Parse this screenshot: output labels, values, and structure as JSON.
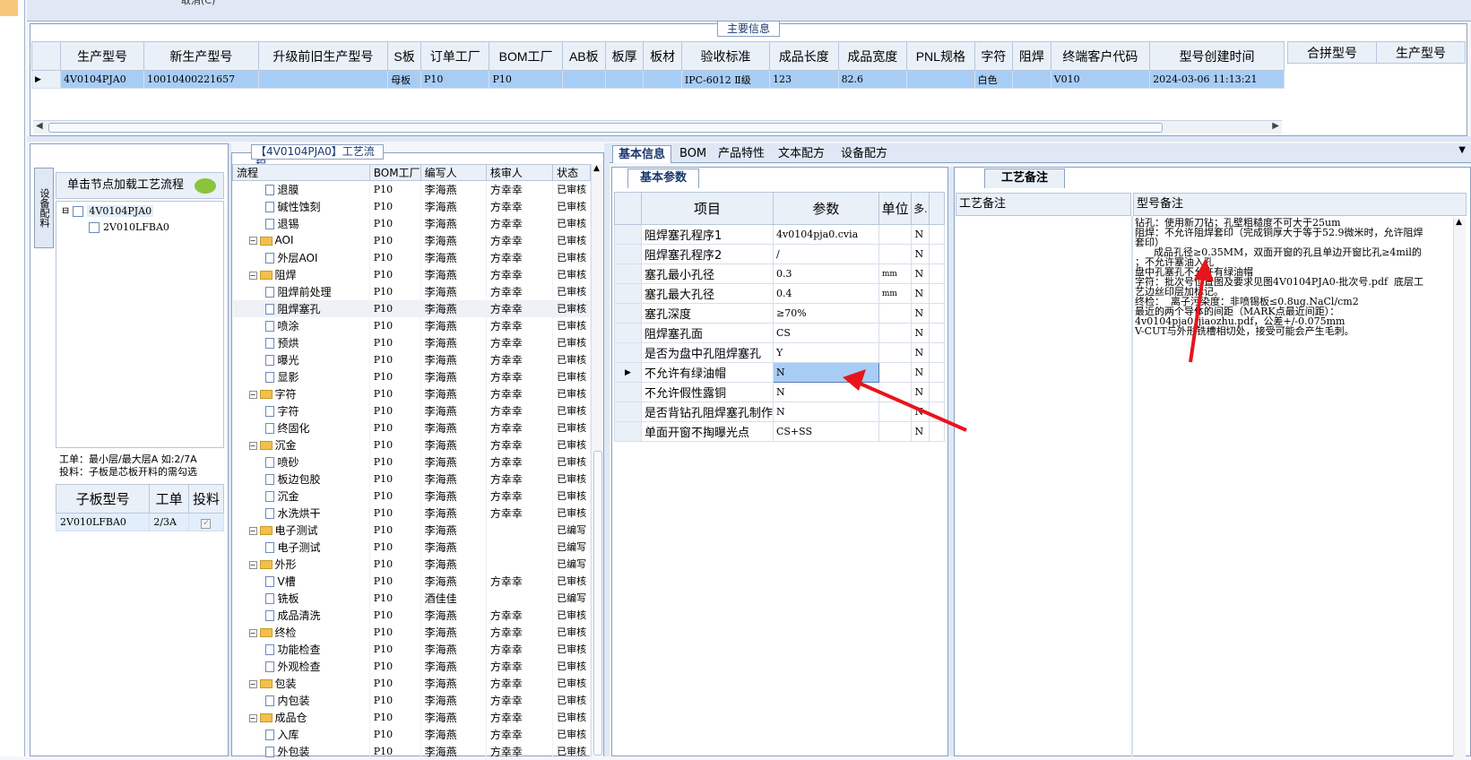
{
  "window": {
    "top_menu_partial": "取消(C)"
  },
  "main_info": {
    "title": "主要信息",
    "columns": [
      "生产型号",
      "新生产型号",
      "升级前旧生产型号",
      "S板",
      "订单工厂",
      "BOM工厂",
      "AB板",
      "板厚",
      "板材",
      "验收标准",
      "成品长度",
      "成品宽度",
      "PNL规格",
      "字符",
      "阻焊",
      "终端客户代码",
      "型号创建时间"
    ],
    "row": [
      "4V0104PJA0",
      "10010400221657",
      "",
      "母板",
      "P10",
      "P10",
      "",
      "",
      "",
      "IPC-6012 Ⅱ级",
      "123",
      "82.6",
      "",
      "白色",
      "",
      "V010",
      "2024-03-06 11:13:21"
    ],
    "merge_columns": [
      "合拼型号",
      "生产型号"
    ]
  },
  "left_panel": {
    "vertical_tab": "设备配料",
    "load_header": "单击节点加载工艺流程",
    "tree": [
      "4V0104PJA0",
      "2V010LFBA0"
    ],
    "work_note_1": "工单：最小层/最大层A 如:2/7A",
    "work_note_2": "投料：子板是芯板开料的需勾选",
    "subgrid": {
      "columns": [
        "子板型号",
        "工单",
        "投料"
      ],
      "rows": [
        {
          "model": "2V010LFBA0",
          "work": "2/3A",
          "check": "✓"
        }
      ]
    }
  },
  "process": {
    "title": "【4V0104PJA0】工艺流程",
    "columns": [
      "流程",
      "BOM工厂",
      "编写人",
      "核审人",
      "状态"
    ],
    "rows": [
      {
        "level": 2,
        "type": "item",
        "name": "退膜",
        "bom": "P10",
        "writer": "李海燕",
        "reviewer": "方幸幸",
        "status": "已审核"
      },
      {
        "level": 2,
        "type": "item",
        "name": "碱性蚀刻",
        "bom": "P10",
        "writer": "李海燕",
        "reviewer": "方幸幸",
        "status": "已审核"
      },
      {
        "level": 2,
        "type": "item",
        "name": "退锡",
        "bom": "P10",
        "writer": "李海燕",
        "reviewer": "方幸幸",
        "status": "已审核"
      },
      {
        "level": 1,
        "type": "folder",
        "name": "AOI",
        "bom": "P10",
        "writer": "李海燕",
        "reviewer": "方幸幸",
        "status": "已审核"
      },
      {
        "level": 2,
        "type": "item",
        "name": "外层AOI",
        "bom": "P10",
        "writer": "李海燕",
        "reviewer": "方幸幸",
        "status": "已审核"
      },
      {
        "level": 1,
        "type": "folder",
        "name": "阻焊",
        "bom": "P10",
        "writer": "李海燕",
        "reviewer": "方幸幸",
        "status": "已审核"
      },
      {
        "level": 2,
        "type": "item",
        "name": "阻焊前处理",
        "bom": "P10",
        "writer": "李海燕",
        "reviewer": "方幸幸",
        "status": "已审核"
      },
      {
        "level": 2,
        "type": "item",
        "name": "阻焊塞孔",
        "bom": "P10",
        "writer": "李海燕",
        "reviewer": "方幸幸",
        "status": "已审核",
        "selected": true
      },
      {
        "level": 2,
        "type": "item",
        "name": "喷涂",
        "bom": "P10",
        "writer": "李海燕",
        "reviewer": "方幸幸",
        "status": "已审核"
      },
      {
        "level": 2,
        "type": "item",
        "name": "预烘",
        "bom": "P10",
        "writer": "李海燕",
        "reviewer": "方幸幸",
        "status": "已审核"
      },
      {
        "level": 2,
        "type": "item",
        "name": "曝光",
        "bom": "P10",
        "writer": "李海燕",
        "reviewer": "方幸幸",
        "status": "已审核"
      },
      {
        "level": 2,
        "type": "item",
        "name": "显影",
        "bom": "P10",
        "writer": "李海燕",
        "reviewer": "方幸幸",
        "status": "已审核"
      },
      {
        "level": 1,
        "type": "folder",
        "name": "字符",
        "bom": "P10",
        "writer": "李海燕",
        "reviewer": "方幸幸",
        "status": "已审核"
      },
      {
        "level": 2,
        "type": "item",
        "name": "字符",
        "bom": "P10",
        "writer": "李海燕",
        "reviewer": "方幸幸",
        "status": "已审核"
      },
      {
        "level": 2,
        "type": "item",
        "name": "终固化",
        "bom": "P10",
        "writer": "李海燕",
        "reviewer": "方幸幸",
        "status": "已审核"
      },
      {
        "level": 1,
        "type": "folder",
        "name": "沉金",
        "bom": "P10",
        "writer": "李海燕",
        "reviewer": "方幸幸",
        "status": "已审核"
      },
      {
        "level": 2,
        "type": "item",
        "name": "喷砂",
        "bom": "P10",
        "writer": "李海燕",
        "reviewer": "方幸幸",
        "status": "已审核"
      },
      {
        "level": 2,
        "type": "item",
        "name": "板边包胶",
        "bom": "P10",
        "writer": "李海燕",
        "reviewer": "方幸幸",
        "status": "已审核"
      },
      {
        "level": 2,
        "type": "item",
        "name": "沉金",
        "bom": "P10",
        "writer": "李海燕",
        "reviewer": "方幸幸",
        "status": "已审核"
      },
      {
        "level": 2,
        "type": "item",
        "name": "水洗烘干",
        "bom": "P10",
        "writer": "李海燕",
        "reviewer": "方幸幸",
        "status": "已审核"
      },
      {
        "level": 1,
        "type": "folder",
        "name": "电子测试",
        "bom": "P10",
        "writer": "李海燕",
        "reviewer": "",
        "status": "已编写"
      },
      {
        "level": 2,
        "type": "item",
        "name": "电子测试",
        "bom": "P10",
        "writer": "李海燕",
        "reviewer": "",
        "status": "已编写"
      },
      {
        "level": 1,
        "type": "folder",
        "name": "外形",
        "bom": "P10",
        "writer": "李海燕",
        "reviewer": "",
        "status": "已编写"
      },
      {
        "level": 2,
        "type": "item",
        "name": "V槽",
        "bom": "P10",
        "writer": "李海燕",
        "reviewer": "方幸幸",
        "status": "已审核"
      },
      {
        "level": 2,
        "type": "item",
        "name": "铣板",
        "bom": "P10",
        "writer": "酒佳佳",
        "reviewer": "",
        "status": "已编写"
      },
      {
        "level": 2,
        "type": "item",
        "name": "成品清洗",
        "bom": "P10",
        "writer": "李海燕",
        "reviewer": "方幸幸",
        "status": "已审核"
      },
      {
        "level": 1,
        "type": "folder",
        "name": "终检",
        "bom": "P10",
        "writer": "李海燕",
        "reviewer": "方幸幸",
        "status": "已审核"
      },
      {
        "level": 2,
        "type": "item",
        "name": "功能检查",
        "bom": "P10",
        "writer": "李海燕",
        "reviewer": "方幸幸",
        "status": "已审核"
      },
      {
        "level": 2,
        "type": "item",
        "name": "外观检查",
        "bom": "P10",
        "writer": "李海燕",
        "reviewer": "方幸幸",
        "status": "已审核"
      },
      {
        "level": 1,
        "type": "folder",
        "name": "包装",
        "bom": "P10",
        "writer": "李海燕",
        "reviewer": "方幸幸",
        "status": "已审核"
      },
      {
        "level": 2,
        "type": "item",
        "name": "内包装",
        "bom": "P10",
        "writer": "李海燕",
        "reviewer": "方幸幸",
        "status": "已审核"
      },
      {
        "level": 1,
        "type": "folder",
        "name": "成品仓",
        "bom": "P10",
        "writer": "李海燕",
        "reviewer": "方幸幸",
        "status": "已审核"
      },
      {
        "level": 2,
        "type": "item",
        "name": "入库",
        "bom": "P10",
        "writer": "李海燕",
        "reviewer": "方幸幸",
        "status": "已审核"
      },
      {
        "level": 2,
        "type": "item",
        "name": "外包装",
        "bom": "P10",
        "writer": "李海燕",
        "reviewer": "方幸幸",
        "status": "已审核"
      }
    ]
  },
  "tabs": [
    "基本信息",
    "BOM",
    "产品特性",
    "文本配方",
    "设备配方"
  ],
  "basic_params": {
    "tab": "基本参数",
    "columns": [
      "项目",
      "参数",
      "单位",
      "多."
    ],
    "rows": [
      {
        "item": "阻焊塞孔程序1",
        "value": "4v0104pja0.cvia",
        "unit": "",
        "flag": "N"
      },
      {
        "item": "阻焊塞孔程序2",
        "value": "/",
        "unit": "",
        "flag": "N"
      },
      {
        "item": "塞孔最小孔径",
        "value": "0.3",
        "unit": "mm",
        "flag": "N"
      },
      {
        "item": "塞孔最大孔径",
        "value": "0.4",
        "unit": "mm",
        "flag": "N"
      },
      {
        "item": "塞孔深度",
        "value": "≥70%",
        "unit": "",
        "flag": "N"
      },
      {
        "item": "阻焊塞孔面",
        "value": "CS",
        "unit": "",
        "flag": "N"
      },
      {
        "item": "是否为盘中孔阻焊塞孔",
        "value": "Y",
        "unit": "",
        "flag": "N"
      },
      {
        "item": "不允许有绿油帽",
        "value": "N",
        "unit": "",
        "flag": "N",
        "selected": true
      },
      {
        "item": "不允许假性露铜",
        "value": "N",
        "unit": "",
        "flag": "N"
      },
      {
        "item": "是否背钻孔阻焊塞孔制作",
        "value": "N",
        "unit": "",
        "flag": "N"
      },
      {
        "item": "单面开窗不掏曝光点",
        "value": "CS+SS",
        "unit": "",
        "flag": "N"
      }
    ]
  },
  "remarks": {
    "tab": "工艺备注",
    "col1": "工艺备注",
    "col2": "型号备注",
    "lines": [
      "钻孔：使用新刀钻；孔壁粗糙度不可大于25um",
      "阻焊：不允许阻焊套印（完成铜厚大于等于52.9微米时，允许阻焊",
      "套印）",
      "      成品孔径≥0.35MM，双面开窗的孔且单边开窗比孔≥4mil的",
      "；不允许塞油入孔",
      "盘中孔塞孔不允许有绿油帽",
      "字符：批次号位置图及要求见图4V0104PJA0-批次号.pdf  底层工",
      "艺边丝印层加标记。",
      "终检：  离子污染度：非喷锡板≤0.8ug.NaCl/cm2",
      "最近的两个导体的间距（MARK点最近间距）：",
      "4v0104pja0_jiaozhu.pdf，公差+/-0.075mm",
      "V-CUT与外形铣槽相切处，接受可能会产生毛刺。"
    ]
  },
  "annotation_color": "#e8141b"
}
